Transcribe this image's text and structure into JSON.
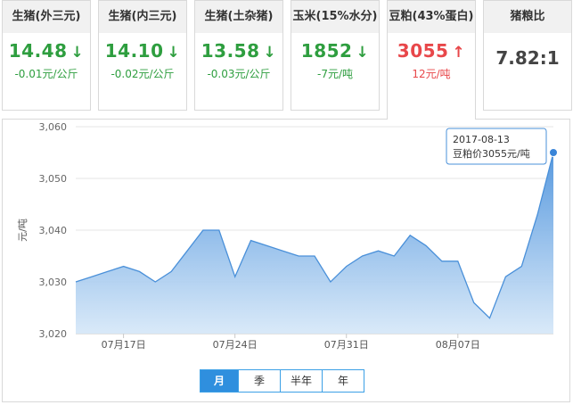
{
  "cards": [
    {
      "title": "生猪(外三元)",
      "price": "14.48",
      "arrow": "↓",
      "change": "-0.01元/公斤",
      "tone": "green"
    },
    {
      "title": "生猪(内三元)",
      "price": "14.10",
      "arrow": "↓",
      "change": "-0.02元/公斤",
      "tone": "green"
    },
    {
      "title": "生猪(土杂猪)",
      "price": "13.58",
      "arrow": "↓",
      "change": "-0.03元/公斤",
      "tone": "green"
    },
    {
      "title": "玉米(15%水分)",
      "price": "1852",
      "arrow": "↓",
      "change": "-7元/吨",
      "tone": "green"
    },
    {
      "title": "豆粕(43%蛋白)",
      "price": "3055",
      "arrow": "↑",
      "change": "12元/吨",
      "tone": "red"
    },
    {
      "title": "猪粮比",
      "price": "7.82:1",
      "arrow": "",
      "change": "",
      "tone": "gray"
    }
  ],
  "active_card": 4,
  "colors": {
    "up": "#e8474a",
    "down": "#2e9e3f",
    "line": "#4a90d9",
    "point": "#3a85d8",
    "button": "#2f8fde"
  },
  "chart_data": {
    "type": "area",
    "ylabel": "元/吨",
    "ylim": [
      3020,
      3060
    ],
    "yticks": [
      3020,
      3030,
      3040,
      3050,
      3060
    ],
    "ytick_labels": [
      "3,020",
      "3,030",
      "3,040",
      "3,050",
      "3,060"
    ],
    "xlim": [
      "2017-07-14",
      "2017-08-13"
    ],
    "xticks": [
      "2017-07-17",
      "2017-07-24",
      "2017-07-31",
      "2017-08-07"
    ],
    "xtick_labels": [
      "07月17日",
      "07月24日",
      "07月31日",
      "08月07日"
    ],
    "grid": true,
    "series": [
      {
        "x": [
          "2017-07-14",
          "2017-07-15",
          "2017-07-16",
          "2017-07-17",
          "2017-07-18",
          "2017-07-19",
          "2017-07-20",
          "2017-07-21",
          "2017-07-22",
          "2017-07-23",
          "2017-07-24",
          "2017-07-25",
          "2017-07-26",
          "2017-07-27",
          "2017-07-28",
          "2017-07-29",
          "2017-07-30",
          "2017-07-31",
          "2017-08-01",
          "2017-08-02",
          "2017-08-03",
          "2017-08-04",
          "2017-08-05",
          "2017-08-06",
          "2017-08-07",
          "2017-08-08",
          "2017-08-09",
          "2017-08-10",
          "2017-08-11",
          "2017-08-12",
          "2017-08-13"
        ],
        "y": [
          3030,
          3031,
          3032,
          3033,
          3032,
          3030,
          3032,
          3036,
          3040,
          3040,
          3031,
          3038,
          3037,
          3036,
          3035,
          3035,
          3030,
          3033,
          3035,
          3036,
          3035,
          3039,
          3037,
          3034,
          3034,
          3026,
          3023,
          3031,
          3033,
          3043,
          3055
        ]
      }
    ],
    "tooltip": {
      "date": "2017-08-13",
      "label": "豆粕价3055元/吨"
    }
  },
  "period_buttons": [
    "月",
    "季",
    "半年",
    "年"
  ],
  "selected_period": 0
}
